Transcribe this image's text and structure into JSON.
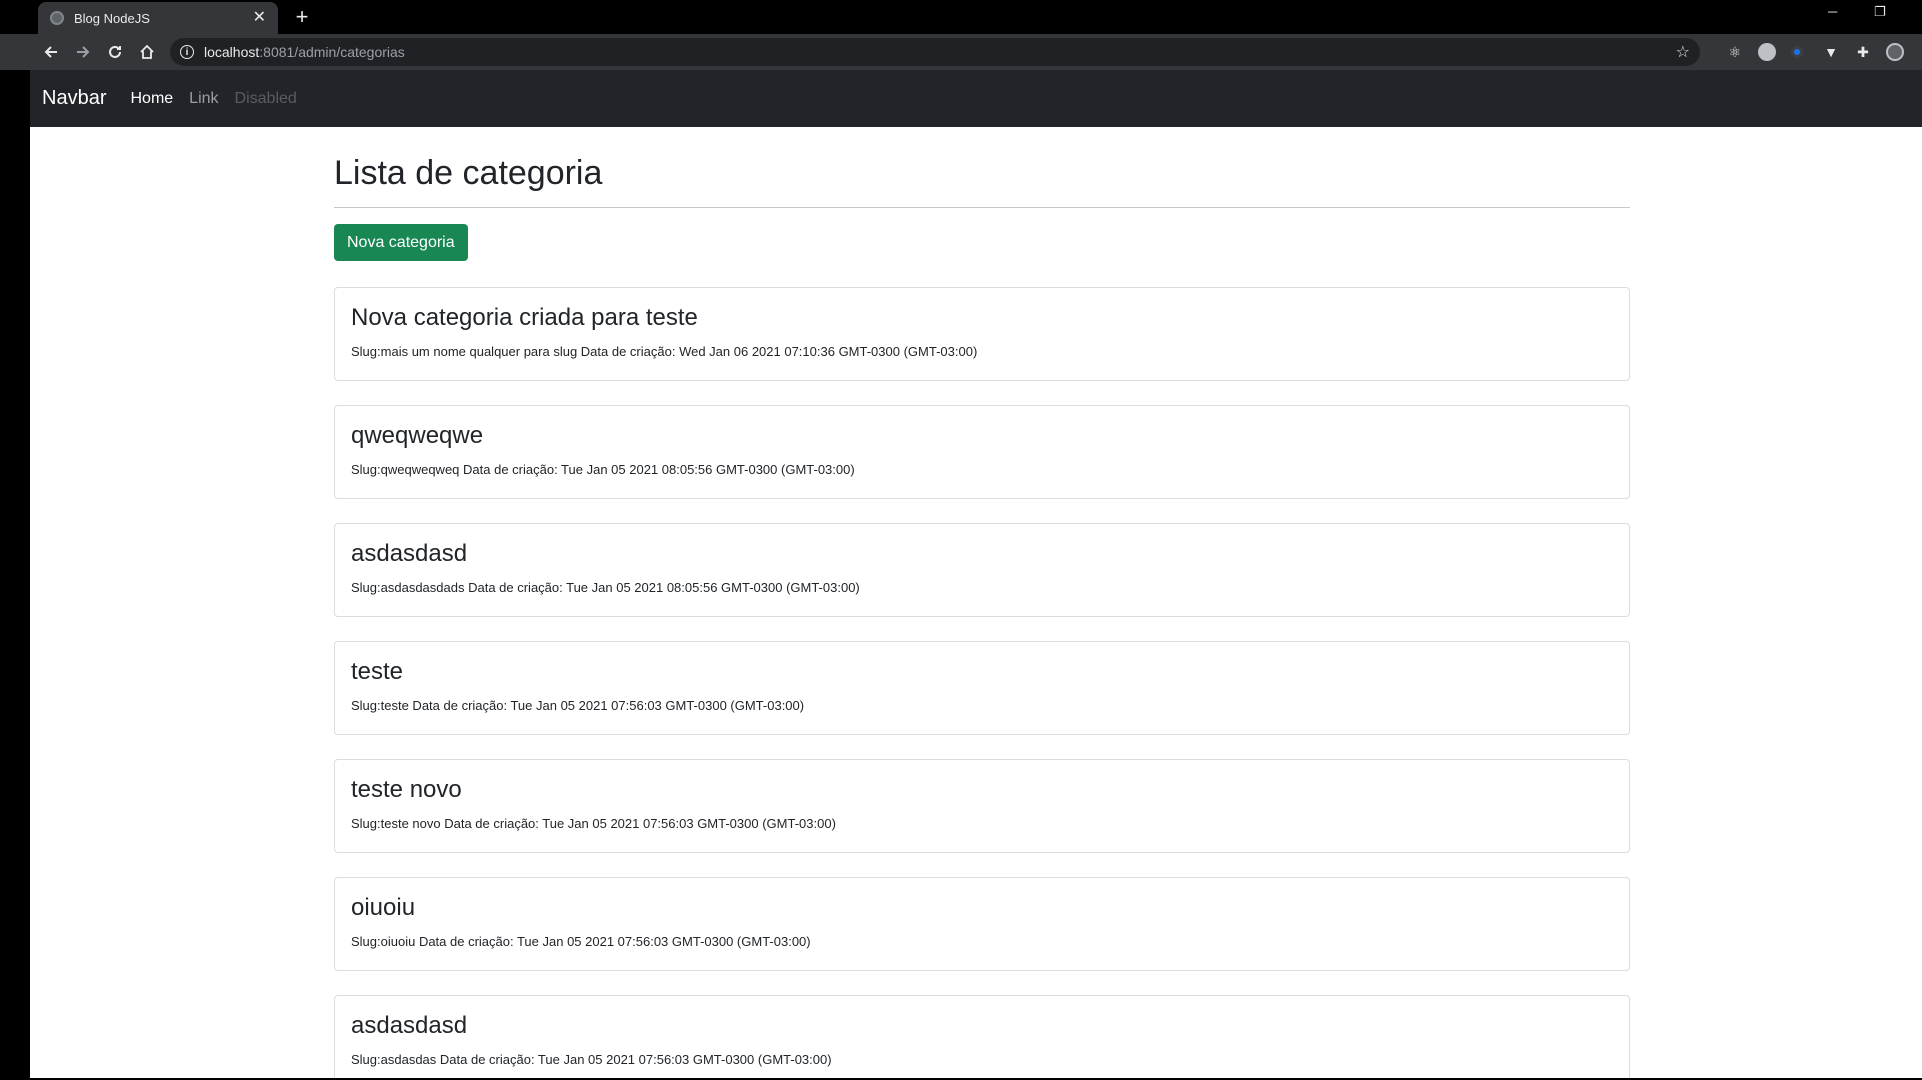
{
  "browser": {
    "tab_title": "Blog NodeJS",
    "tab_close": "✕",
    "new_tab": "+",
    "url_host": "localhost",
    "url_path": ":8081/admin/categorias",
    "win_minimize": "─",
    "win_restore": "❐"
  },
  "navbar": {
    "brand": "Navbar",
    "links": [
      {
        "label": "Home",
        "state": "active"
      },
      {
        "label": "Link",
        "state": "normal"
      },
      {
        "label": "Disabled",
        "state": "disabled"
      }
    ]
  },
  "main": {
    "title": "Lista de categoria",
    "new_button": "Nova categoria",
    "categories": [
      {
        "title": "Nova categoria criada para teste",
        "meta": "Slug:mais um nome qualquer para slug Data de criação: Wed Jan 06 2021 07:10:36 GMT-0300 (GMT-03:00)"
      },
      {
        "title": "qweqweqwe",
        "meta": "Slug:qweqweqweq Data de criação: Tue Jan 05 2021 08:05:56 GMT-0300 (GMT-03:00)"
      },
      {
        "title": "asdasdasd",
        "meta": "Slug:asdasdasdads Data de criação: Tue Jan 05 2021 08:05:56 GMT-0300 (GMT-03:00)"
      },
      {
        "title": "teste",
        "meta": "Slug:teste Data de criação: Tue Jan 05 2021 07:56:03 GMT-0300 (GMT-03:00)"
      },
      {
        "title": "teste novo",
        "meta": "Slug:teste novo Data de criação: Tue Jan 05 2021 07:56:03 GMT-0300 (GMT-03:00)"
      },
      {
        "title": "oiuoiu",
        "meta": "Slug:oiuoiu Data de criação: Tue Jan 05 2021 07:56:03 GMT-0300 (GMT-03:00)"
      },
      {
        "title": "asdasdasd",
        "meta": "Slug:asdasdas Data de criação: Tue Jan 05 2021 07:56:03 GMT-0300 (GMT-03:00)"
      }
    ]
  },
  "colors": {
    "navbar_bg": "#212529",
    "button_success": "#198754",
    "chrome_toolbar": "#35363a"
  }
}
